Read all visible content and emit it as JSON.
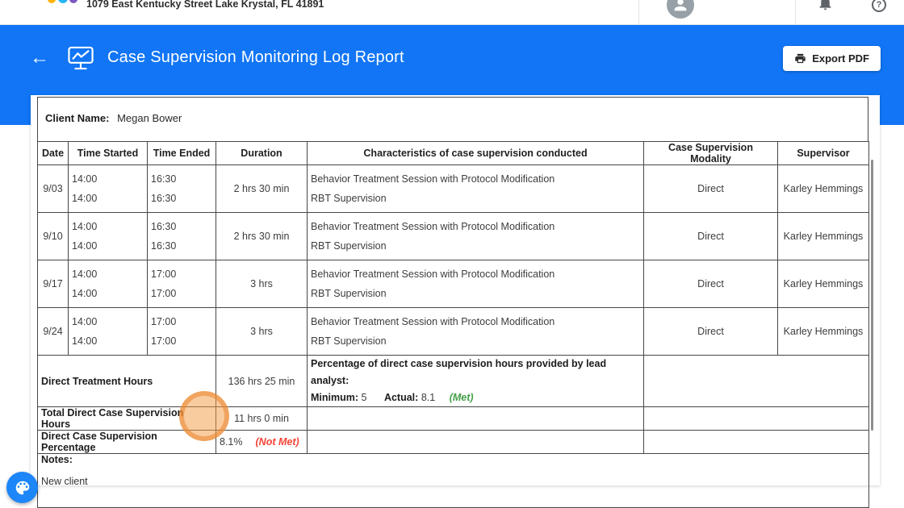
{
  "topbar": {
    "address": "1079 East Kentucky Street Lake Krystal, FL 41891",
    "help_glyph": "?"
  },
  "header": {
    "back_glyph": "←",
    "title": "Case Supervision Monitoring Log Report",
    "export_button": "Export PDF"
  },
  "report": {
    "client": {
      "label": "Client Name:",
      "value": "Megan Bower"
    },
    "table": {
      "columns": [
        "Date",
        "Time Started",
        "Time Ended",
        "Duration",
        "Characteristics of case supervision conducted",
        "Case Supervision Modality",
        "Supervisor"
      ],
      "rows": [
        {
          "date": "9/03",
          "time_started": [
            "14:00",
            "14:00"
          ],
          "time_ended": [
            "16:30",
            "16:30"
          ],
          "duration": "2 hrs 30 min",
          "characteristics": [
            "Behavior Treatment Session with Protocol Modification",
            "RBT Supervision"
          ],
          "modality": "Direct",
          "supervisor": "Karley Hemmings"
        },
        {
          "date": "9/10",
          "time_started": [
            "14:00",
            "14:00"
          ],
          "time_ended": [
            "16:30",
            "16:30"
          ],
          "duration": "2 hrs 30 min",
          "characteristics": [
            "Behavior Treatment Session with Protocol Modification",
            "RBT Supervision"
          ],
          "modality": "Direct",
          "supervisor": "Karley Hemmings"
        },
        {
          "date": "9/17",
          "time_started": [
            "14:00",
            "14:00"
          ],
          "time_ended": [
            "17:00",
            "17:00"
          ],
          "duration": "3 hrs",
          "characteristics": [
            "Behavior Treatment Session with Protocol Modification",
            "RBT Supervision"
          ],
          "modality": "Direct",
          "supervisor": "Karley Hemmings"
        },
        {
          "date": "9/24",
          "time_started": [
            "14:00",
            "14:00"
          ],
          "time_ended": [
            "17:00",
            "17:00"
          ],
          "duration": "3 hrs",
          "characteristics": [
            "Behavior Treatment Session with Protocol Modification",
            "RBT Supervision"
          ],
          "modality": "Direct",
          "supervisor": "Karley Hemmings"
        }
      ]
    },
    "summary": {
      "direct_treatment": {
        "label": "Direct Treatment Hours",
        "value": "136 hrs 25 min"
      },
      "lead_analyst": {
        "heading": "Percentage of direct case supervision hours provided by lead analyst:",
        "minimum_label": "Minimum:",
        "minimum_value": "5",
        "actual_label": "Actual:",
        "actual_value": "8.1",
        "status": "(Met)"
      },
      "total_supervision": {
        "label": "Total Direct Case Supervision Hours",
        "value": "11 hrs 0 min"
      },
      "supervision_percentage": {
        "label": "Direct Case Supervision Percentage",
        "value": "8.1%",
        "status": "(Not Met)"
      }
    },
    "notes": {
      "label": "Notes:",
      "value": "New client"
    }
  },
  "colors": {
    "header_blue": "#1175F5",
    "met_green": "#43A047",
    "not_met_red": "#F44336",
    "highlight_orange": "#F0953C"
  }
}
